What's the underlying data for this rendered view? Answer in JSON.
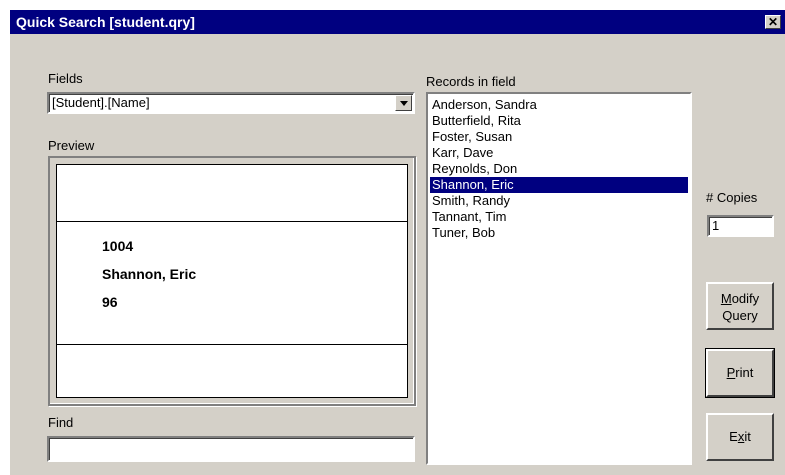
{
  "window": {
    "title": "Quick Search [student.qry]",
    "close_glyph": "✕"
  },
  "fields": {
    "label": "Fields",
    "selected": "[Student].[Name]"
  },
  "preview": {
    "label": "Preview",
    "lines": [
      "1004",
      "Shannon, Eric",
      "96"
    ]
  },
  "find": {
    "label": "Find",
    "value": ""
  },
  "records": {
    "label": "Records in field",
    "items": [
      "Anderson, Sandra",
      "Butterfield, Rita",
      "Foster, Susan",
      "Karr, Dave",
      "Reynolds, Don",
      "Shannon, Eric",
      "Smith, Randy",
      "Tannant, Tim",
      "Tuner, Bob"
    ],
    "selected": "Shannon, Eric"
  },
  "copies": {
    "label": "# Copies",
    "value": "1"
  },
  "buttons": {
    "modify_line1_first": "M",
    "modify_line1_rest": "odify",
    "modify_line2": "Query",
    "print_first": "P",
    "print_rest": "rint",
    "exit_first": "E",
    "exit_mid": "x",
    "exit_rest": "it"
  },
  "colors": {
    "titlebar": "#000080",
    "face": "#d4d0c8",
    "selection": "#000080"
  }
}
